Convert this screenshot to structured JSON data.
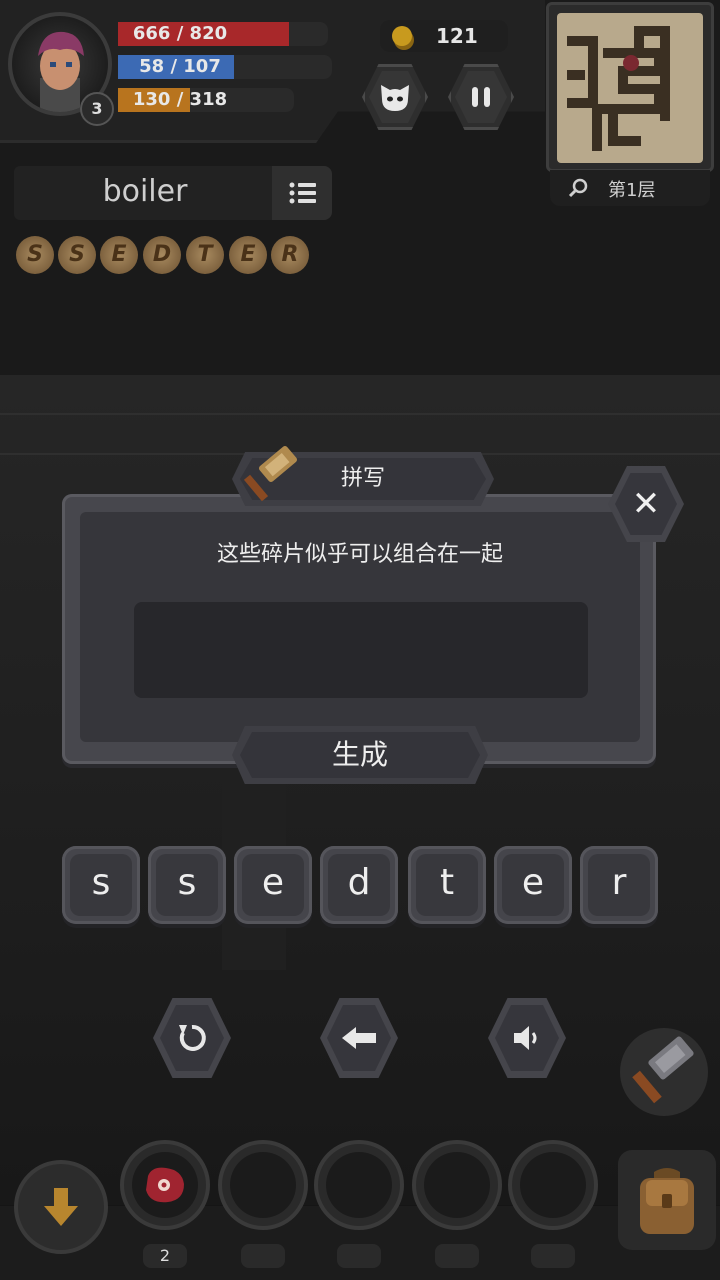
{
  "hud": {
    "level": "3",
    "hp": {
      "text": "666 / 820",
      "current": 666,
      "max": 820,
      "color": "#a8282a"
    },
    "mp": {
      "text": "58 / 107",
      "current": 58,
      "max": 107,
      "color": "#3c6ab4"
    },
    "xp": {
      "text": "130 / 318",
      "current": 130,
      "max": 318,
      "color": "#b8741e"
    },
    "coins": "121",
    "floor": "第1层"
  },
  "word_panel": {
    "word": "boiler",
    "fragments": [
      "S",
      "S",
      "E",
      "D",
      "T",
      "E",
      "R"
    ]
  },
  "dialog": {
    "title": "拼写",
    "message": "这些碎片似乎可以组合在一起",
    "input_value": "",
    "generate_label": "生成",
    "close_label": "✕"
  },
  "letters": [
    "s",
    "s",
    "e",
    "d",
    "t",
    "e",
    "r"
  ],
  "inventory": {
    "slots": [
      {
        "item": "meat",
        "count": "2"
      },
      {
        "item": "",
        "count": ""
      },
      {
        "item": "",
        "count": ""
      },
      {
        "item": "",
        "count": ""
      },
      {
        "item": "",
        "count": ""
      }
    ]
  },
  "icons": {
    "refresh": "refresh-icon",
    "backspace": "backspace-icon",
    "sound": "speaker-icon",
    "pause": "pause-icon",
    "pet": "cat-face-icon",
    "search": "search-icon",
    "hammer": "hammer-icon",
    "bag": "backpack-icon",
    "down": "arrow-down-icon"
  }
}
